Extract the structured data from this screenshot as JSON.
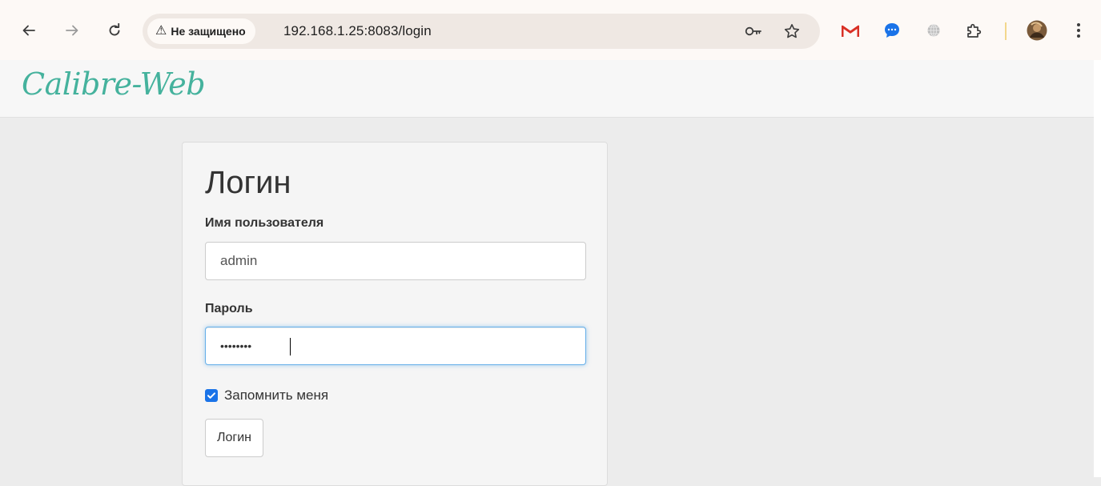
{
  "browser": {
    "security_label": "Не защищено",
    "url": "192.168.1.25:8083/login",
    "icons": {
      "back": "arrow-left-icon",
      "forward": "arrow-right-icon",
      "reload": "reload-icon",
      "warning": "warning-triangle-icon",
      "password": "key-icon",
      "bookmark": "star-icon",
      "gmail": "gmail-icon",
      "messenger": "chat-bubble-icon",
      "translate": "globe-icon",
      "extensions": "puzzle-icon",
      "profile": "avatar-icon",
      "menu": "kebab-menu-icon"
    },
    "colors": {
      "gmail": "#d93025",
      "messenger": "#1a73e8",
      "divider": "#f3d78c"
    }
  },
  "app": {
    "brand": "Calibre-Web",
    "brand_color": "#45b29d"
  },
  "login": {
    "title": "Логин",
    "username_label": "Имя пользователя",
    "username_value": "admin",
    "password_label": "Пароль",
    "password_value": "••••••••",
    "remember_label": "Запомнить меня",
    "remember_checked": true,
    "submit_label": "Логин"
  }
}
